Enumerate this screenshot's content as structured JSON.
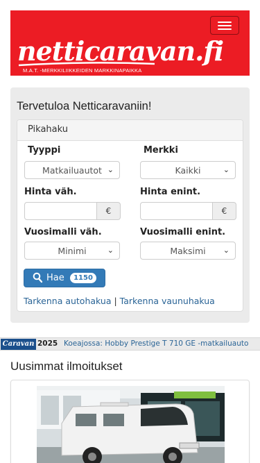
{
  "header": {
    "logo_text": "netticaravan.fi",
    "logo_tagline": "M.A.T. -MERKKILIIKKEIDEN MARKKINAPAIKKA",
    "brand_color": "#ec1c24"
  },
  "welcome": {
    "title": "Tervetuloa Netticaravaniin!"
  },
  "quick_search": {
    "heading": "Pikahaku",
    "type_label": "Tyyppi",
    "type_value": "Matkailuautot",
    "make_label": "Merkki",
    "make_value": "Kaikki",
    "price_min_label": "Hinta väh.",
    "price_max_label": "Hinta enint.",
    "currency_symbol": "€",
    "year_min_label": "Vuosimalli väh.",
    "year_min_value": "Minimi",
    "year_max_label": "Vuosimalli enint.",
    "year_max_value": "Maksimi",
    "search_button_label": "Hae",
    "result_count": "1150",
    "refine_car_link": "Tarkenna autohakua",
    "link_separator": "|",
    "refine_trailer_link": "Tarkenna vaunuhakua"
  },
  "ticker": {
    "logo_text": "Caravan",
    "year": "2025",
    "headline": "Koeajossa: Hobby Prestige T 710 GE -matkailuauto"
  },
  "latest": {
    "title": "Uusimmat ilmoitukset"
  },
  "icons": {
    "menu": "hamburger-icon",
    "search": "search-icon",
    "chevron": "chevron-down-icon"
  }
}
